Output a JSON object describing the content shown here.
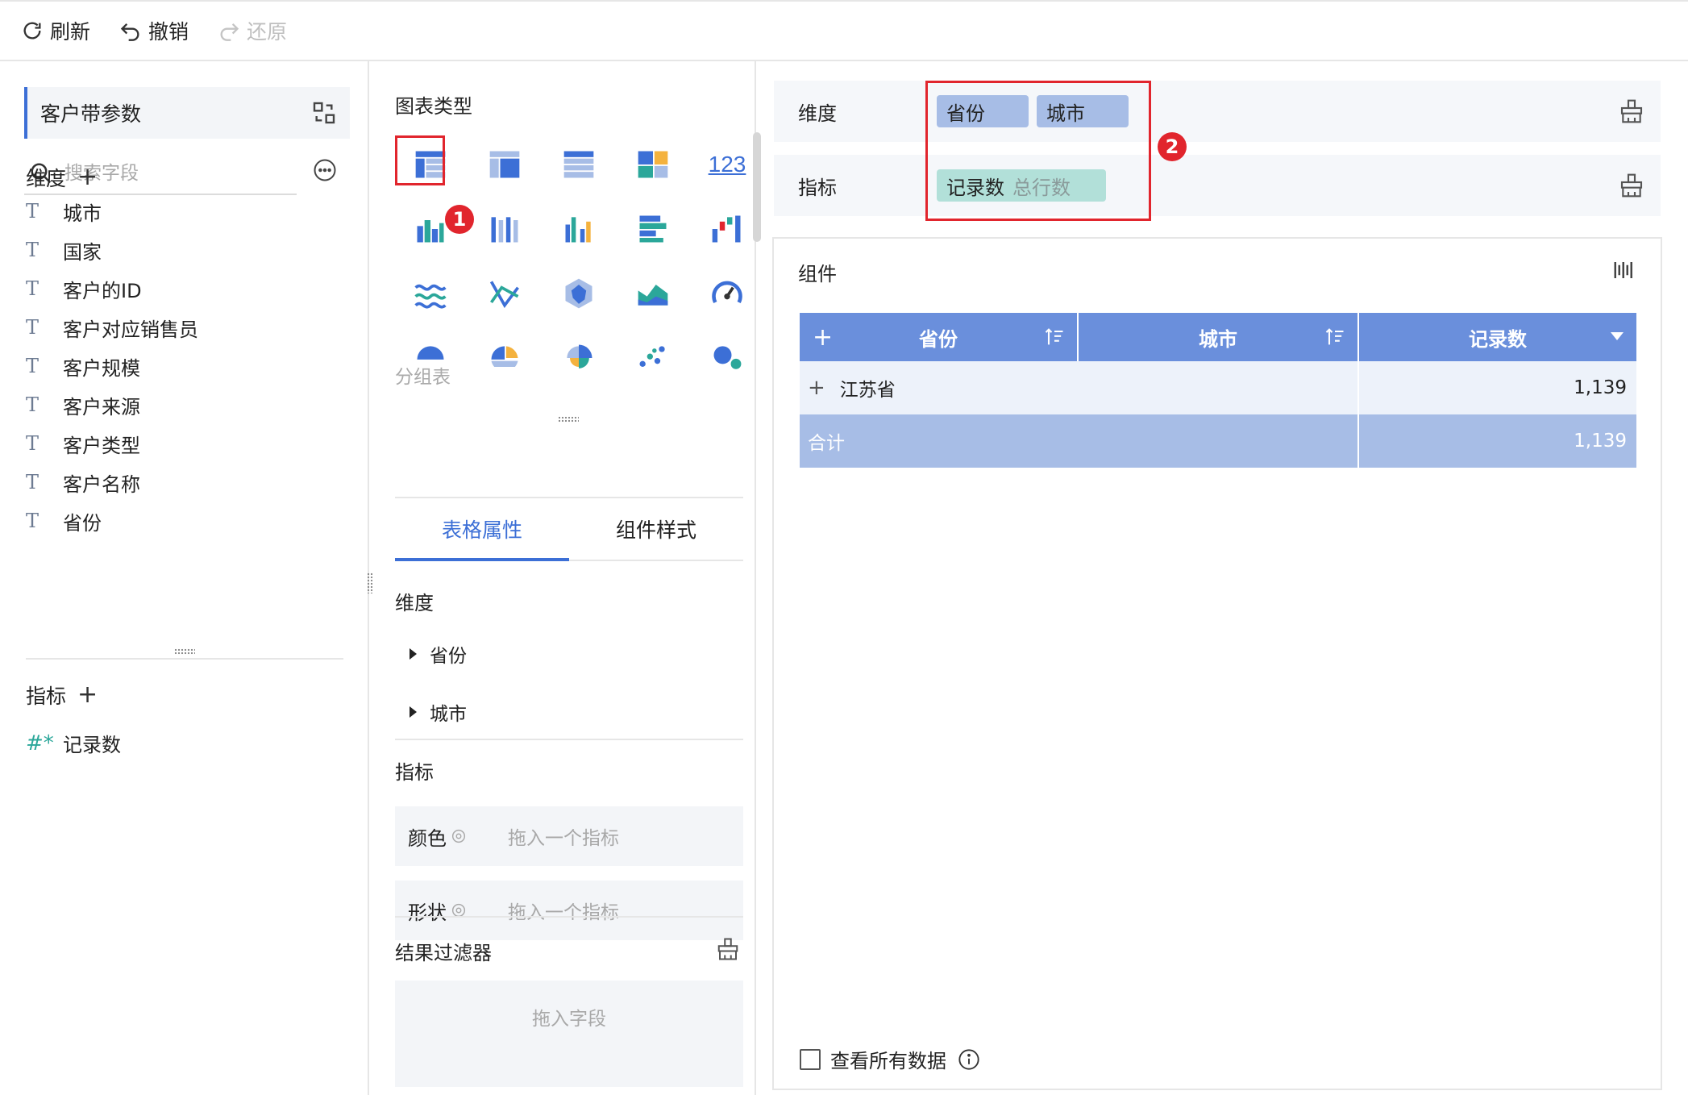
{
  "toolbar": {
    "refresh": "刷新",
    "undo": "撤销",
    "redo": "还原"
  },
  "left_panel": {
    "dataset_name": "客户带参数",
    "search_placeholder": "搜索字段",
    "dimensions_title": "维度",
    "dimensions": [
      "城市",
      "国家",
      "客户的ID",
      "客户对应销售员",
      "客户规模",
      "客户来源",
      "客户类型",
      "客户名称",
      "省份"
    ],
    "measures_title": "指标",
    "measures": [
      "记录数"
    ]
  },
  "middle_panel": {
    "chart_type_title": "图表类型",
    "chart_icons": [
      "group-table-icon",
      "cross-table-icon",
      "detail-table-icon",
      "treemap-table-icon",
      "kpi-number-icon",
      "grouped-bar-icon",
      "stacked-bar-icon",
      "multi-bar-icon",
      "horizontal-bar-icon",
      "waterfall-icon",
      "line-icon",
      "scatter-line-icon",
      "radar-icon",
      "area-icon",
      "gauge-icon",
      "pie-icon",
      "donut-pie-icon",
      "rose-icon",
      "dot-scatter-icon",
      "bubble-icon"
    ],
    "selected_chart_caption": "分组表",
    "badge_1": "1",
    "kpi_text": "123",
    "tabs": [
      "表格属性",
      "组件样式"
    ],
    "active_tab": "表格属性",
    "dimension_title": "维度",
    "dimension_items": [
      "省份",
      "城市"
    ],
    "measure_title": "指标",
    "color_label": "颜色",
    "shape_label": "形状",
    "drop_measure_placeholder": "拖入一个指标",
    "filter_title": "结果过滤器",
    "drop_field_placeholder": "拖入字段"
  },
  "right_panel": {
    "dimension_shelf_label": "维度",
    "dimension_pills": [
      "省份",
      "城市"
    ],
    "measure_shelf_label": "指标",
    "measure_pill": "记录数",
    "measure_pill_sub": "总行数",
    "badge_2": "2",
    "component_title": "组件",
    "table": {
      "headers": [
        "省份",
        "城市",
        "记录数"
      ],
      "expand_symbol": "+",
      "rows": [
        {
          "province": "江苏省",
          "city": "",
          "count": "1,139"
        }
      ],
      "total_label": "合计",
      "total_value": "1,139"
    },
    "view_all_label": "查看所有数据"
  },
  "colors": {
    "accent": "#3c6fd6",
    "header_bg": "#6a8fdc",
    "total_bg": "#a7bde6",
    "dimension_pill": "#a7bde6",
    "measure_pill": "#b2e0d9",
    "highlight_red": "#e1252d"
  }
}
